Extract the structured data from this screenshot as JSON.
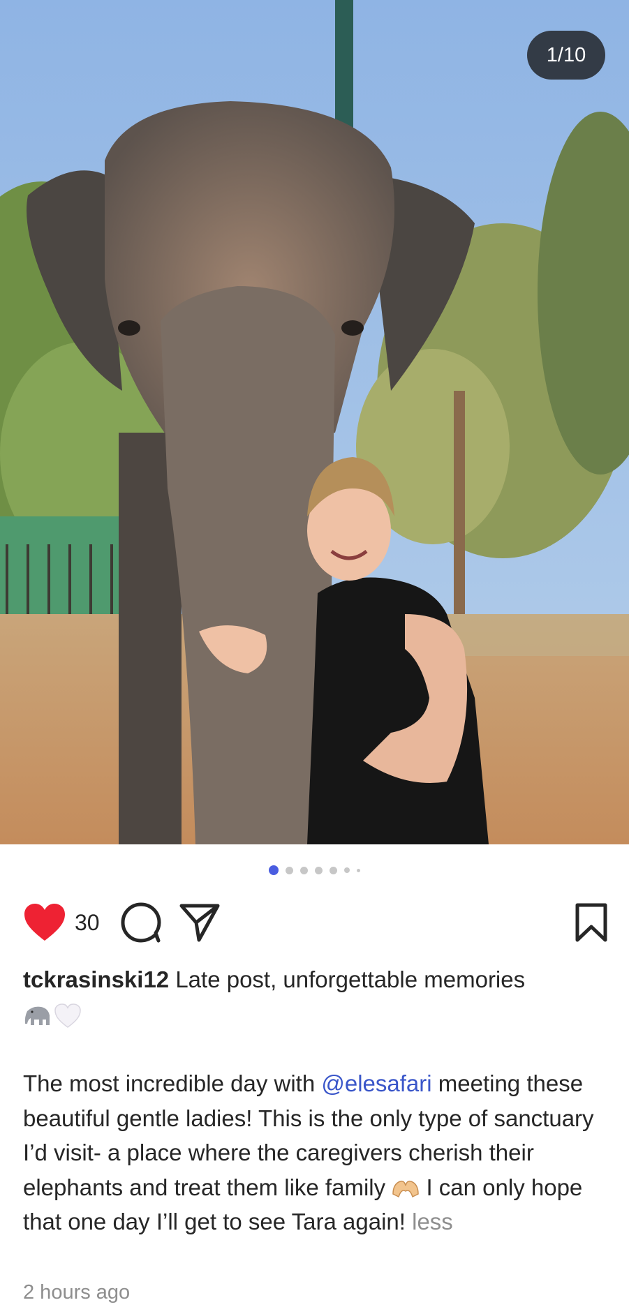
{
  "photo": {
    "counter": "1/10",
    "carousel": {
      "total": 7,
      "active_index": 0
    }
  },
  "actions": {
    "like_count": "30"
  },
  "caption": {
    "username": "tckrasinski12",
    "text": "Late post, unforgettable memories",
    "emoji": [
      "elephant-emoji",
      "white-heart-emoji"
    ]
  },
  "body": {
    "part1": "The most incredible day with ",
    "mention": "@elesafari",
    "part2": " meeting these beautiful gentle ladies! This is the only type of sanctuary I’d visit- a place where the caregivers cherish their elephants and treat them like family ",
    "part3": " I can only hope that one day I’ll get to see Tara again! ",
    "less": "less"
  },
  "timestamp": "2 hours ago",
  "colors": {
    "like": "#ee2233",
    "mention": "#3a56c9",
    "dot_active": "#4a5de0",
    "muted": "#8e8e8e"
  }
}
